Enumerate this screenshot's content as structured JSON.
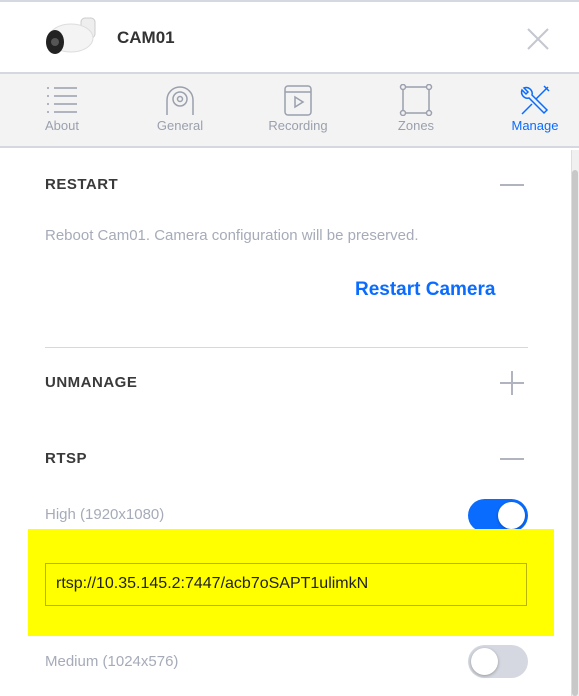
{
  "header": {
    "title": "CAM01",
    "close_icon": "close-icon"
  },
  "tabs": [
    {
      "label": "About",
      "icon": "list-icon",
      "active": false
    },
    {
      "label": "General",
      "icon": "camera-icon",
      "active": false
    },
    {
      "label": "Recording",
      "icon": "video-icon",
      "active": false
    },
    {
      "label": "Zones",
      "icon": "zone-icon",
      "active": false
    },
    {
      "label": "Manage",
      "icon": "tools-icon",
      "active": true
    }
  ],
  "restart": {
    "title": "RESTART",
    "description": "Reboot Cam01. Camera configuration will be preserved.",
    "button": "Restart Camera",
    "expanded": true
  },
  "unmanage": {
    "title": "UNMANAGE",
    "expanded": false
  },
  "rtsp": {
    "title": "RTSP",
    "expanded": true,
    "streams": [
      {
        "label": "High (1920x1080)",
        "enabled": true,
        "url": "rtsp://10.35.145.2:7447/acb7oSAPT1ulimkN"
      },
      {
        "label": "Medium (1024x576)",
        "enabled": false
      }
    ]
  },
  "colors": {
    "accent": "#0a6cff",
    "highlight": "#ffff00",
    "toggle_off": "#d5d8e0"
  }
}
